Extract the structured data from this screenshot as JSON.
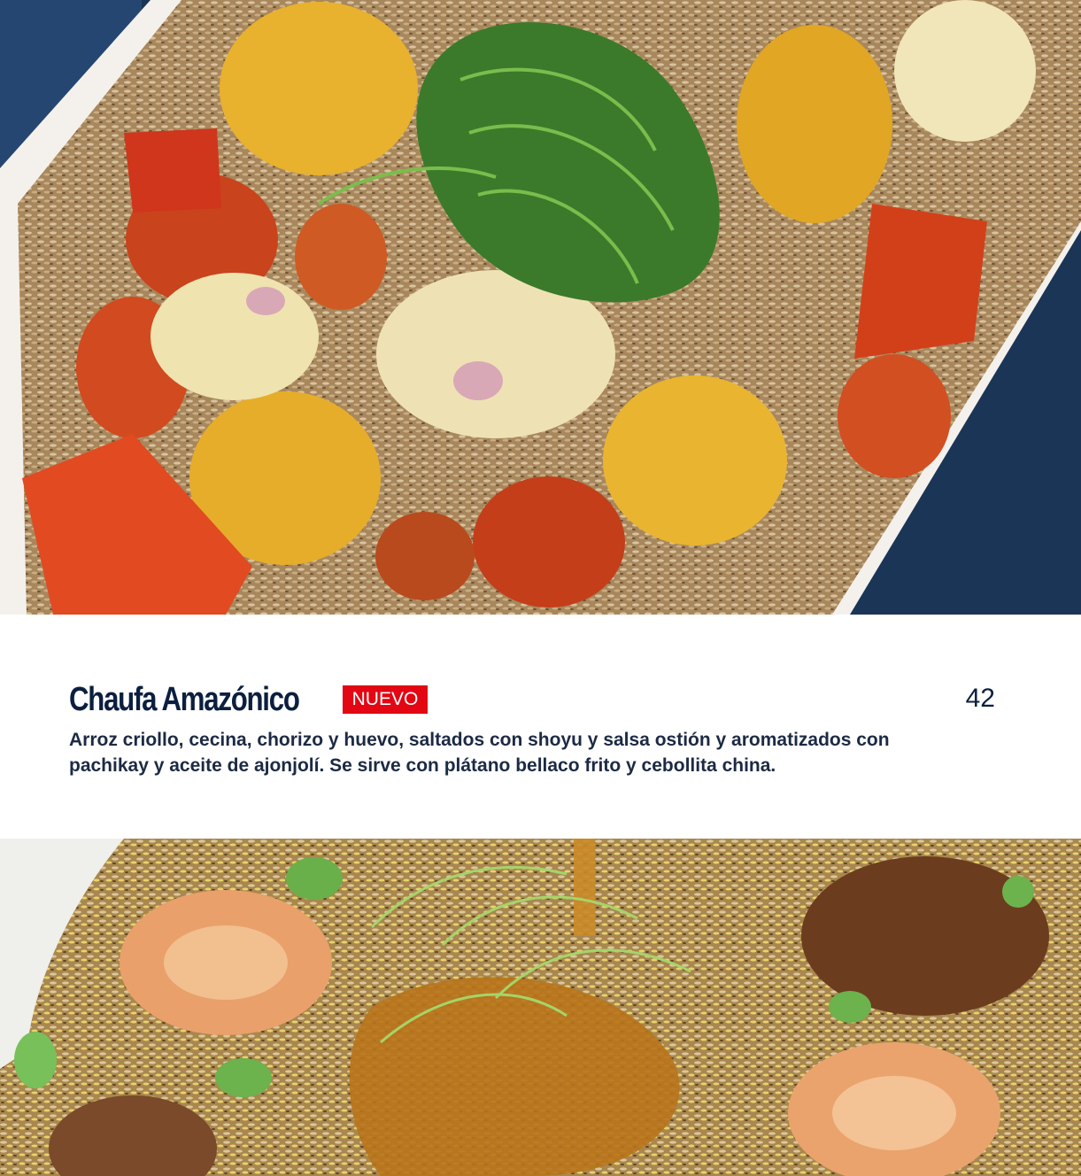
{
  "menu_item": {
    "title": "Chaufa Amazónico",
    "badge": "NUEVO",
    "price": "42",
    "description": "Arroz criollo, cecina, chorizo y huevo, saltados con shoyu y salsa ostión y aromatizados con pachikay y aceite de ajonjolí. Se sirve con plátano bellaco frito y cebollita china."
  },
  "colors": {
    "title": "#0c1f3f",
    "badge_background": "#e30613",
    "badge_text": "#ffffff",
    "description": "#1c2a44",
    "page_background": "#ffffff"
  }
}
